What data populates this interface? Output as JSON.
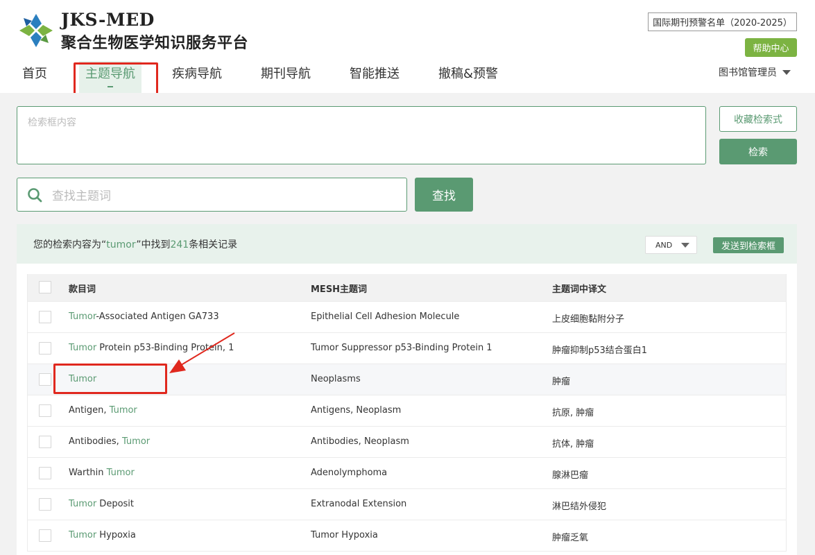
{
  "header": {
    "brand_en": "JKS-MED",
    "brand_cn": "聚合生物医学知识服务平台",
    "warning_button": "国际期刊预警名单（2020-2025）",
    "help_button": "帮助中心",
    "user": "图书馆管理员"
  },
  "nav": {
    "items": [
      {
        "label": "首页"
      },
      {
        "label": "主题导航",
        "active": true
      },
      {
        "label": "疾病导航"
      },
      {
        "label": "期刊导航"
      },
      {
        "label": "智能推送"
      },
      {
        "label": "撤稿&预警"
      }
    ]
  },
  "search": {
    "query_placeholder": "检索框内容",
    "save_button": "收藏检索式",
    "search_button": "检索",
    "term_placeholder": "查找主题词",
    "find_button": "查找"
  },
  "results": {
    "prefix": "您的检索内容为“",
    "keyword": "tumor",
    "middle": "”中找到",
    "count": "241",
    "suffix": "条相关记录",
    "operator": "AND",
    "send_button": "发送到检索框",
    "columns": [
      "款目词",
      "MESH主题词",
      "主题词中译文"
    ],
    "rows": [
      {
        "entry_parts": [
          {
            "text": "Tumor",
            "hl": true
          },
          {
            "text": "-Associated Antigen GA733",
            "hl": false
          }
        ],
        "mesh": "Epithelial Cell Adhesion Molecule",
        "cn": "上皮细胞黏附分子"
      },
      {
        "entry_parts": [
          {
            "text": "Tumor",
            "hl": true
          },
          {
            "text": " Protein p53-Binding Protein, 1",
            "hl": false
          }
        ],
        "mesh": "Tumor Suppressor p53-Binding Protein 1",
        "cn": "肿瘤抑制p53结合蛋白1"
      },
      {
        "entry_parts": [
          {
            "text": "Tumor",
            "hl": true
          }
        ],
        "mesh": "Neoplasms",
        "cn": "肿瘤"
      },
      {
        "entry_parts": [
          {
            "text": "Antigen, ",
            "hl": false
          },
          {
            "text": "Tumor",
            "hl": true
          }
        ],
        "mesh": "Antigens, Neoplasm",
        "cn": "抗原, 肿瘤"
      },
      {
        "entry_parts": [
          {
            "text": "Antibodies, ",
            "hl": false
          },
          {
            "text": "Tumor",
            "hl": true
          }
        ],
        "mesh": "Antibodies, Neoplasm",
        "cn": "抗体, 肿瘤"
      },
      {
        "entry_parts": [
          {
            "text": "Warthin ",
            "hl": false
          },
          {
            "text": "Tumor",
            "hl": true
          }
        ],
        "mesh": "Adenolymphoma",
        "cn": "腺淋巴瘤"
      },
      {
        "entry_parts": [
          {
            "text": "Tumor",
            "hl": true
          },
          {
            "text": " Deposit",
            "hl": false
          }
        ],
        "mesh": "Extranodal Extension",
        "cn": "淋巴结外侵犯"
      },
      {
        "entry_parts": [
          {
            "text": "Tumor",
            "hl": true
          },
          {
            "text": " Hypoxia",
            "hl": false
          }
        ],
        "mesh": "Tumor Hypoxia",
        "cn": "肿瘤乏氧"
      }
    ]
  },
  "colors": {
    "accent": "#5a9a72",
    "help_green": "#7cb342",
    "annotation_red": "#e0281e"
  }
}
